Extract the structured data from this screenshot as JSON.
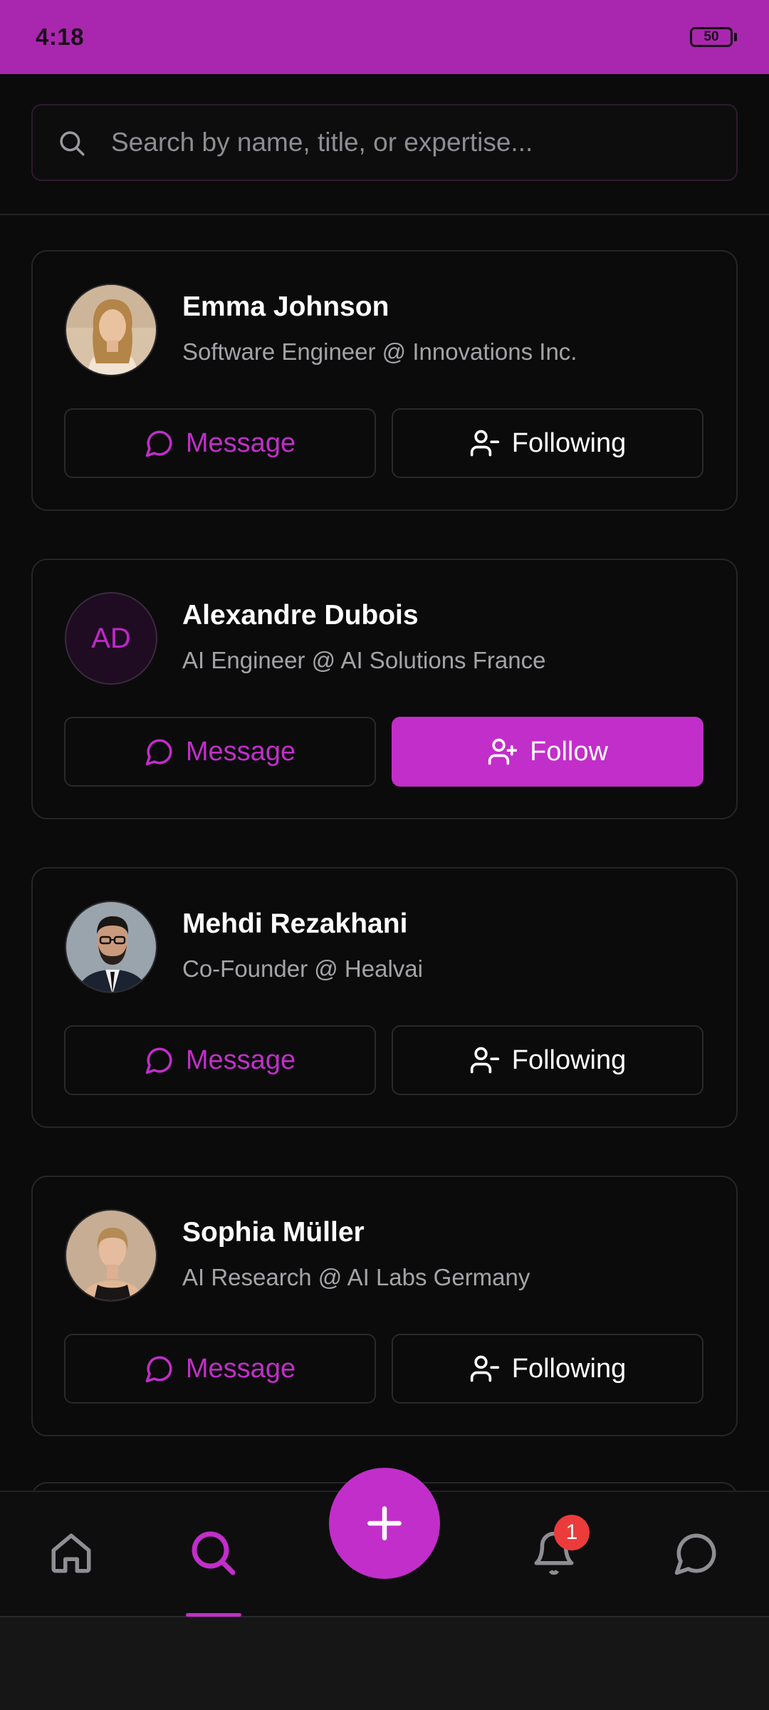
{
  "status_bar": {
    "time": "4:18",
    "battery": "50"
  },
  "search": {
    "placeholder": "Search by name, title, or expertise...",
    "value": ""
  },
  "colors": {
    "accent": "#c22ec9",
    "status_bar": "#a927ae",
    "background": "#0b0b0c",
    "badge": "#ec3b3b"
  },
  "people": [
    {
      "name": "Emma Johnson",
      "title": "Software Engineer @ Innovations Inc.",
      "avatar": "photo-woman-blonde",
      "message_label": "Message",
      "follow_label": "Following",
      "following": true
    },
    {
      "name": "Alexandre Dubois",
      "title": "AI Engineer @ AI Solutions France",
      "avatar_initials": "AD",
      "message_label": "Message",
      "follow_label": "Follow",
      "following": false
    },
    {
      "name": "Mehdi Rezakhani",
      "title": "Co-Founder @ Healvai",
      "avatar": "photo-man-glasses-suit",
      "message_label": "Message",
      "follow_label": "Following",
      "following": true
    },
    {
      "name": "Sophia Müller",
      "title": "AI Research @ AI Labs Germany",
      "avatar": "photo-woman-tank-top",
      "message_label": "Message",
      "follow_label": "Following",
      "following": true
    }
  ],
  "bottom_nav": {
    "items": [
      "home-icon",
      "search-icon",
      "plus-icon",
      "bell-icon",
      "chat-icon"
    ],
    "active": "search",
    "notification_count": "1"
  }
}
